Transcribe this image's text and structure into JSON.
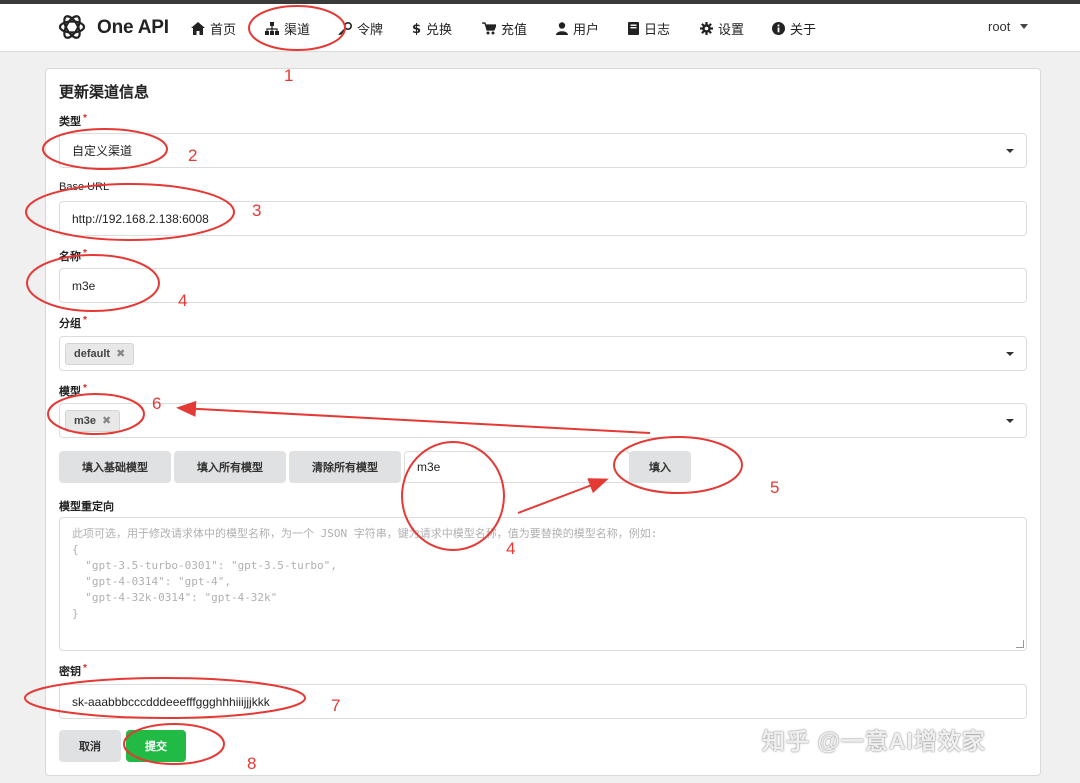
{
  "app": {
    "brand": "One API",
    "nav": [
      {
        "label": "首页",
        "icon": "home-icon"
      },
      {
        "label": "渠道",
        "icon": "sitemap-icon"
      },
      {
        "label": "令牌",
        "icon": "key-icon"
      },
      {
        "label": "兑换",
        "icon": "dollar-icon"
      },
      {
        "label": "充值",
        "icon": "cart-icon"
      },
      {
        "label": "用户",
        "icon": "user-icon"
      },
      {
        "label": "日志",
        "icon": "book-icon"
      },
      {
        "label": "设置",
        "icon": "gear-icon"
      },
      {
        "label": "关于",
        "icon": "info-icon"
      }
    ],
    "user": "root"
  },
  "form": {
    "title": "更新渠道信息",
    "required_mark": "*",
    "type": {
      "label": "类型",
      "value": "自定义渠道"
    },
    "base_url": {
      "label": "Base URL",
      "value": "http://192.168.2.138:6008"
    },
    "name": {
      "label": "名称",
      "value": "m3e"
    },
    "group": {
      "label": "分组",
      "chips": [
        "default"
      ]
    },
    "models": {
      "label": "模型",
      "chips": [
        "m3e"
      ]
    },
    "model_buttons": {
      "fill_basic": "填入基础模型",
      "fill_all": "填入所有模型",
      "clear_all": "清除所有模型",
      "custom_model_value": "m3e",
      "fill": "填入"
    },
    "model_mapping": {
      "label": "模型重定向",
      "placeholder": "此项可选，用于修改请求体中的模型名称，为一个 JSON 字符串，键为请求中模型名称，值为要替换的模型名称，例如:\n{\n  \"gpt-3.5-turbo-0301\": \"gpt-3.5-turbo\",\n  \"gpt-4-0314\": \"gpt-4\",\n  \"gpt-4-32k-0314\": \"gpt-4-32k\"\n}"
    },
    "key": {
      "label": "密钥",
      "value": "sk-aaabbbcccdddeeefffggghhhiiijjjkkk"
    },
    "cancel": "取消",
    "submit": "提交"
  },
  "annotations": [
    "1",
    "2",
    "3",
    "4",
    "6",
    "4",
    "5",
    "7",
    "8"
  ],
  "watermark": "知乎 @一意AI增效家",
  "colors": {
    "annotation": "#e53935",
    "submit": "#21ba45",
    "required": "#db2828"
  }
}
